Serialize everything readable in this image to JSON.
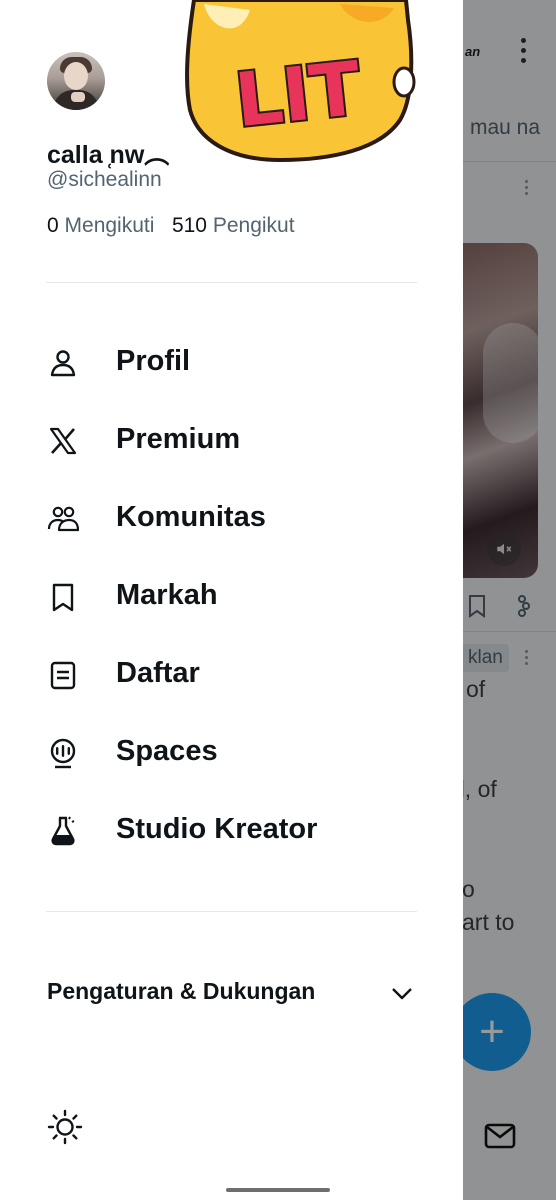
{
  "background": {
    "brand_text": "an",
    "tab_label": "mau na",
    "ad_badge": "klan",
    "text_lines": [
      "of",
      "d, of",
      "o",
      "art to"
    ],
    "fab_label": "+"
  },
  "sticker": {
    "text": "LIT"
  },
  "profile": {
    "display_name": "calla ̜nw︵",
    "handle": "@sichealinn",
    "following_count": "0",
    "following_label": "Mengikuti",
    "followers_count": "510",
    "followers_label": "Pengikut"
  },
  "menu": {
    "items": [
      {
        "label": "Profil",
        "icon": "person-icon"
      },
      {
        "label": "Premium",
        "icon": "x-logo-icon"
      },
      {
        "label": "Komunitas",
        "icon": "communities-icon"
      },
      {
        "label": "Markah",
        "icon": "bookmark-icon"
      },
      {
        "label": "Daftar",
        "icon": "list-icon"
      },
      {
        "label": "Spaces",
        "icon": "spaces-icon"
      },
      {
        "label": "Studio Kreator",
        "icon": "creator-studio-icon"
      }
    ]
  },
  "settings": {
    "label": "Pengaturan & Dukungan"
  },
  "colors": {
    "text_primary": "#0f1419",
    "text_secondary": "#536471",
    "accent": "#1d9bf0",
    "sticker_fill": "#f9c536",
    "sticker_letters": "#e8345a"
  }
}
